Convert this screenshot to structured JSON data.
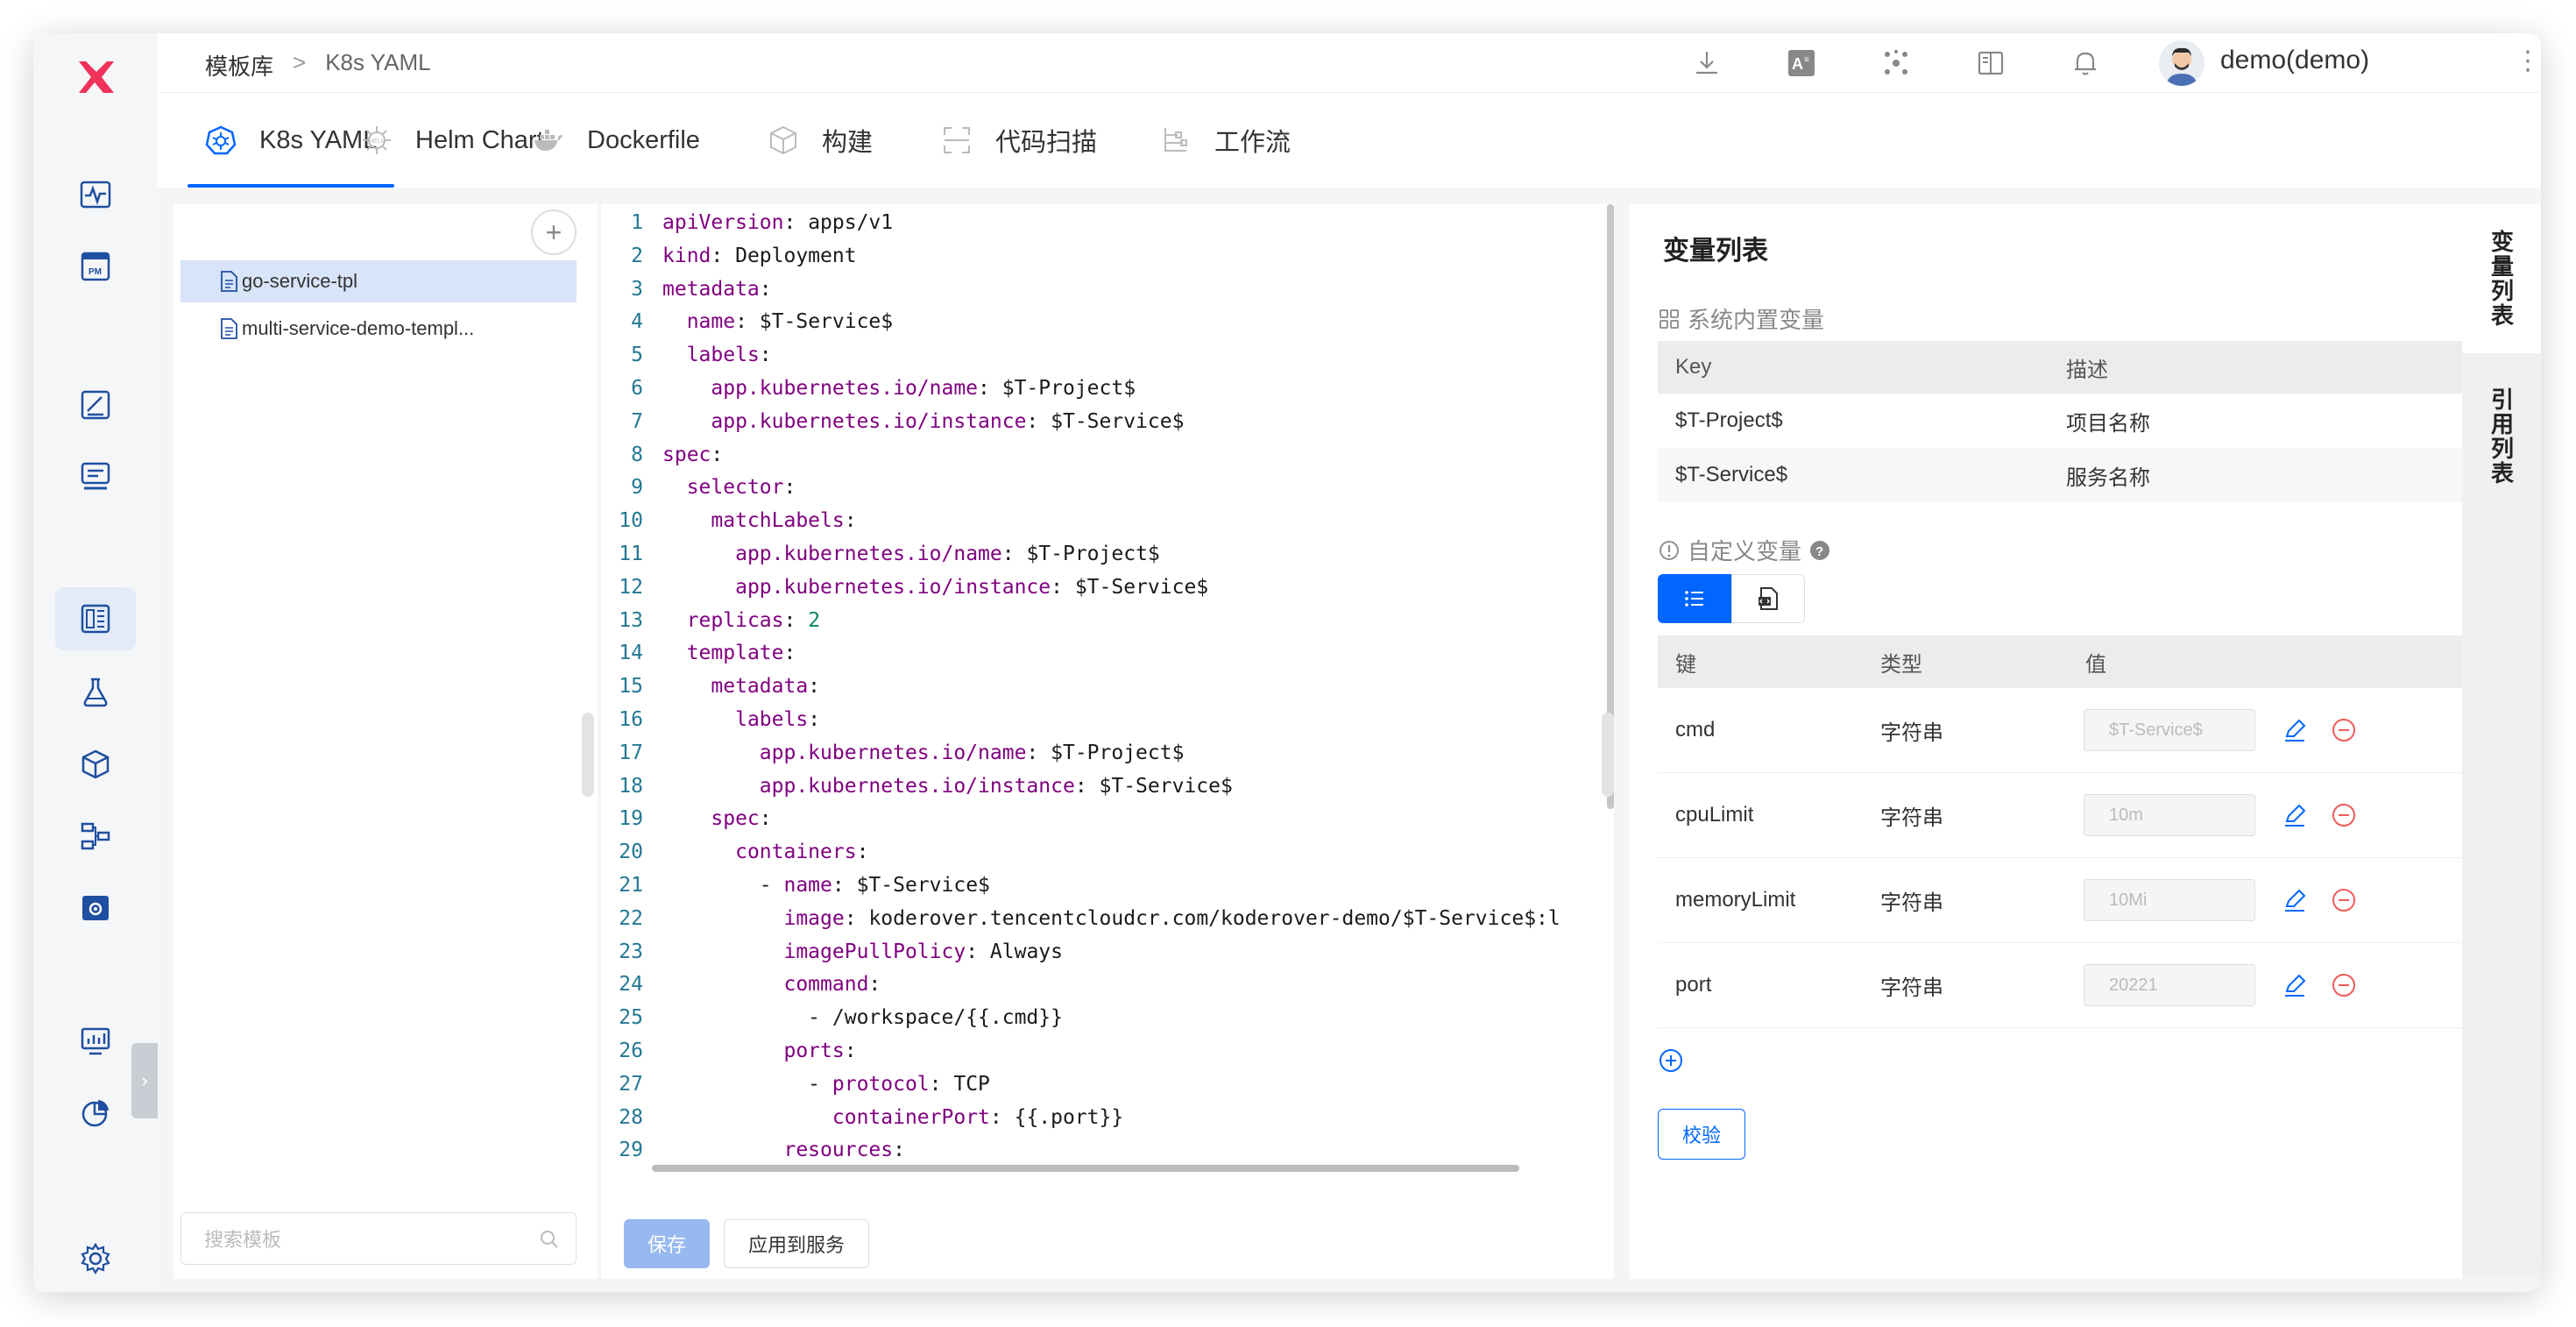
{
  "header": {
    "breadcrumb": [
      "模板库",
      ">",
      "K8s YAML"
    ],
    "username": "demo(demo)",
    "more": "⋮"
  },
  "tabs": [
    {
      "label": "K8s YAML",
      "icon": "kubernetes-icon"
    },
    {
      "label": "Helm Chart",
      "icon": "helm-icon"
    },
    {
      "label": "Dockerfile",
      "icon": "docker-icon"
    },
    {
      "label": "构建",
      "icon": "cube-icon"
    },
    {
      "label": "代码扫描",
      "icon": "scan-icon"
    },
    {
      "label": "工作流",
      "icon": "workflow-icon"
    }
  ],
  "tree": {
    "add": "+",
    "items": [
      "go-service-tpl",
      "multi-service-demo-templ..."
    ],
    "search_placeholder": "搜索模板"
  },
  "editor": {
    "save": "保存",
    "apply": "应用到服务",
    "lines": [
      {
        "n": "1",
        "indent": "",
        "key": "apiVersion",
        "val": " apps/v1"
      },
      {
        "n": "2",
        "indent": "",
        "key": "kind",
        "val": " Deployment"
      },
      {
        "n": "3",
        "indent": "",
        "key": "metadata",
        "val": ""
      },
      {
        "n": "4",
        "indent": "  ",
        "key": "name",
        "val": " $T-Service$"
      },
      {
        "n": "5",
        "indent": "  ",
        "key": "labels",
        "val": ""
      },
      {
        "n": "6",
        "indent": "    ",
        "key": "app.kubernetes.io/name",
        "val": " $T-Project$"
      },
      {
        "n": "7",
        "indent": "    ",
        "key": "app.kubernetes.io/instance",
        "val": " $T-Service$"
      },
      {
        "n": "8",
        "indent": "",
        "key": "spec",
        "val": ""
      },
      {
        "n": "9",
        "indent": "  ",
        "key": "selector",
        "val": ""
      },
      {
        "n": "10",
        "indent": "    ",
        "key": "matchLabels",
        "val": ""
      },
      {
        "n": "11",
        "indent": "      ",
        "key": "app.kubernetes.io/name",
        "val": " $T-Project$"
      },
      {
        "n": "12",
        "indent": "      ",
        "key": "app.kubernetes.io/instance",
        "val": " $T-Service$"
      },
      {
        "n": "13",
        "indent": "  ",
        "key": "replicas",
        "val": " 2"
      },
      {
        "n": "14",
        "indent": "  ",
        "key": "template",
        "val": ""
      },
      {
        "n": "15",
        "indent": "    ",
        "key": "metadata",
        "val": ""
      },
      {
        "n": "16",
        "indent": "      ",
        "key": "labels",
        "val": ""
      },
      {
        "n": "17",
        "indent": "        ",
        "key": "app.kubernetes.io/name",
        "val": " $T-Project$"
      },
      {
        "n": "18",
        "indent": "        ",
        "key": "app.kubernetes.io/instance",
        "val": " $T-Service$"
      },
      {
        "n": "19",
        "indent": "    ",
        "key": "spec",
        "val": ""
      },
      {
        "n": "20",
        "indent": "      ",
        "key": "containers",
        "val": ""
      },
      {
        "n": "21",
        "indent": "        - ",
        "key": "name",
        "val": " $T-Service$"
      },
      {
        "n": "22",
        "indent": "          ",
        "key": "image",
        "val": " koderover.tencentcloudcr.com/koderover-demo/$T-Service$:l"
      },
      {
        "n": "23",
        "indent": "          ",
        "key": "imagePullPolicy",
        "val": " Always"
      },
      {
        "n": "24",
        "indent": "          ",
        "key": "command",
        "val": ""
      },
      {
        "n": "25",
        "indent": "            - ",
        "key": "",
        "val": "/workspace/{{.cmd}}"
      },
      {
        "n": "26",
        "indent": "          ",
        "key": "ports",
        "val": ""
      },
      {
        "n": "27",
        "indent": "            - ",
        "key": "protocol",
        "val": " TCP"
      },
      {
        "n": "28",
        "indent": "              ",
        "key": "containerPort",
        "val": " {{.port}}"
      },
      {
        "n": "29",
        "indent": "          ",
        "key": "resources",
        "val": ""
      }
    ]
  },
  "vars": {
    "title": "变量列表",
    "system_title": "系统内置变量",
    "system_headers": [
      "Key",
      "描述"
    ],
    "system_rows": [
      {
        "key": "$T-Project$",
        "desc": "项目名称"
      },
      {
        "key": "$T-Service$",
        "desc": "服务名称"
      }
    ],
    "custom_title": "自定义变量",
    "custom_headers": [
      "键",
      "类型",
      "值"
    ],
    "custom_rows": [
      {
        "key": "cmd",
        "type": "字符串",
        "value": "$T-Service$"
      },
      {
        "key": "cpuLimit",
        "type": "字符串",
        "value": "10m"
      },
      {
        "key": "memoryLimit",
        "type": "字符串",
        "value": "10Mi"
      },
      {
        "key": "port",
        "type": "字符串",
        "value": "20221"
      }
    ],
    "check": "校验"
  },
  "side_tabs": [
    "变量列表",
    "引用列表"
  ],
  "colors": {
    "accent": "#0066ff",
    "logo": "#f0325a",
    "danger": "#f05a5a"
  }
}
